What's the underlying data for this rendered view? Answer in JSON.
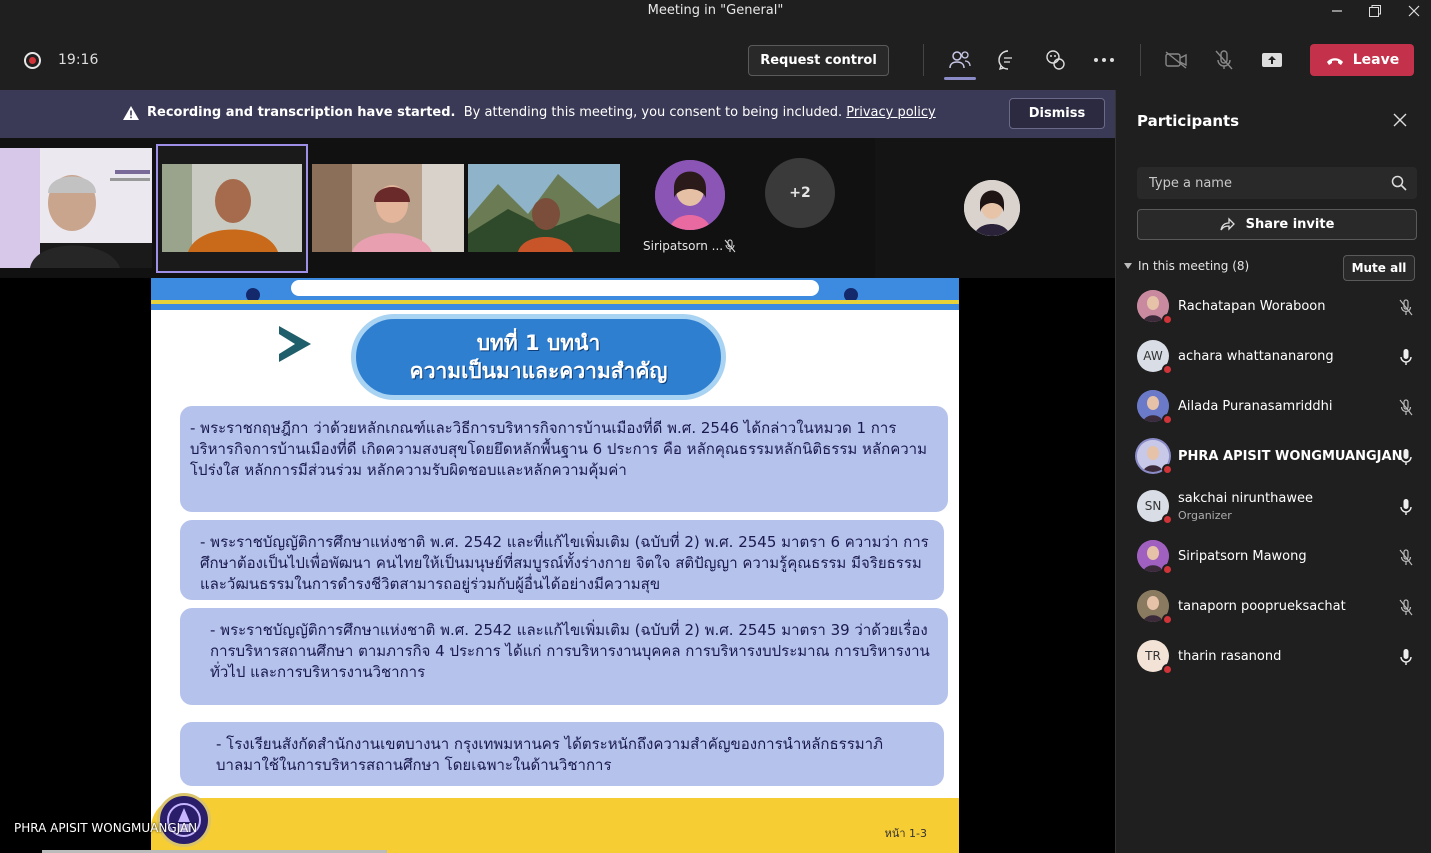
{
  "window": {
    "title": "Meeting in \"General\""
  },
  "toolbar": {
    "timer": "19:16",
    "request_control": "Request control",
    "leave": "Leave",
    "colors": {
      "leave_bg": "#c4314b",
      "accent": "#8b8cc7"
    }
  },
  "banner": {
    "bold": "Recording and transcription have started.",
    "text": "By attending this meeting, you consent to being included.",
    "link": "Privacy policy",
    "dismiss": "Dismiss"
  },
  "strip": {
    "tile_name": "Siripatsorn ...",
    "more": "+2"
  },
  "slide": {
    "title_line1": "บทที่ 1 บทนำ",
    "title_line2": "ความเป็นมาและความสำคัญ",
    "box1": "- พระราชกฤษฎีกา ว่าด้วยหลักเกณฑ์และวิธีการบริหารกิจการบ้านเมืองที่ดี พ.ศ. 2546 ได้กล่าวในหมวด 1 การบริหารกิจการบ้านเมืองที่ดี เกิดความสงบสุขโดยยึดหลักพื้นฐาน 6 ประการ คือ หลักคุณธรรมหลักนิติธรรม หลักความโปร่งใส หลักการมีส่วนร่วม หลักความรับผิดชอบและหลักความคุ้มค่า",
    "box2": "- พระราชบัญญัติการศึกษาแห่งชาติ พ.ศ. 2542 และที่แก้ไขเพิ่มเติม (ฉบับที่ 2) พ.ศ. 2545 มาตรา 6 ความว่า การศึกษาต้องเป็นไปเพื่อพัฒนา คนไทยให้เป็นมนุษย์ที่สมบูรณ์ทั้งร่างกาย จิตใจ สติปัญญา ความรู้คุณธรรม มีจริยธรรมและวัฒนธรรมในการดำรงชีวิตสามารถอยู่ร่วมกับผู้อื่นได้อย่างมีความสุข",
    "box3": "- พระราชบัญญัติการศึกษาแห่งชาติ พ.ศ. 2542 และแก้ไขเพิ่มเติม (ฉบับที่ 2) พ.ศ. 2545 มาตรา 39 ว่าด้วยเรื่อง การบริหารสถานศึกษา ตามภารกิจ 4 ประการ ได้แก่ การบริหารงานบุคคล การบริหารงบประมาณ การบริหารงานทั่วไป และการบริหารงานวิชาการ",
    "box4": "- โรงเรียนสังกัดสำนักงานเขตบางนา กรุงเทพมหานคร ได้ตระหนักถึงความสำคัญของการนำหลักธรรมาภิบาลมาใช้ในการบริหารสถานศึกษา โดยเฉพาะในด้านวิชาการ",
    "page": "หน้า 1-3"
  },
  "stage": {
    "speaker": "PHRA APISIT WONGMUANGJAN"
  },
  "participants": {
    "title": "Participants",
    "search_placeholder": "Type a name",
    "share_invite": "Share invite",
    "section": "In this meeting (8)",
    "mute_all": "Mute all",
    "list": [
      {
        "name": "Rachatapan Woraboon",
        "initials": "",
        "role": "",
        "mic": "muted"
      },
      {
        "name": "achara whattananarong",
        "initials": "AW",
        "role": "",
        "mic": "on"
      },
      {
        "name": "Ailada Puranasamriddhi",
        "initials": "",
        "role": "",
        "mic": "muted"
      },
      {
        "name": "PHRA APISIT WONGMUANGJAN",
        "initials": "",
        "role": "",
        "mic": "on"
      },
      {
        "name": "sakchai nirunthawee",
        "initials": "SN",
        "role": "Organizer",
        "mic": "on"
      },
      {
        "name": "Siripatsorn Mawong",
        "initials": "",
        "role": "",
        "mic": "muted"
      },
      {
        "name": "tanaporn pooprueksachat",
        "initials": "",
        "role": "",
        "mic": "muted"
      },
      {
        "name": "tharin rasanond",
        "initials": "TR",
        "role": "",
        "mic": "on"
      }
    ]
  }
}
